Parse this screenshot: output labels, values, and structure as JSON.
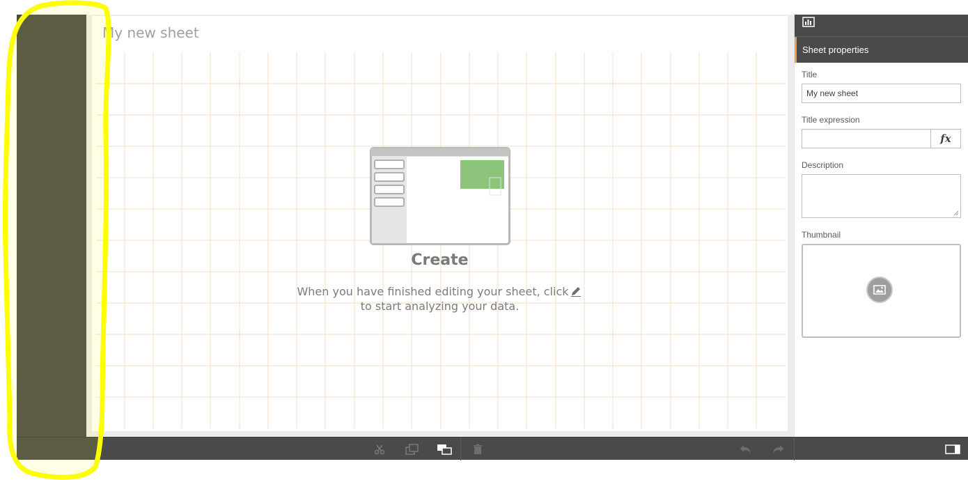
{
  "sheet": {
    "title": "My new sheet"
  },
  "empty_state": {
    "title": "Create",
    "description_before_icon": "When you have finished editing your sheet, click",
    "description_after_icon": "to start analyzing your data.",
    "inline_icon": "pencil-icon"
  },
  "properties_panel": {
    "top_icon": "chart-icon",
    "header": "Sheet properties",
    "title_label": "Title",
    "title_value": "My new sheet",
    "title_expression_label": "Title expression",
    "title_expression_value": "",
    "fx_label": "fx",
    "description_label": "Description",
    "description_value": "",
    "thumbnail_label": "Thumbnail",
    "thumbnail_icon": "image-icon"
  },
  "toolbar": {
    "buttons": [
      "cut-icon",
      "copy-icon",
      "paste-icon",
      "delete-icon",
      "undo-icon",
      "redo-icon",
      "toggle-panel-icon"
    ]
  },
  "colors": {
    "dark_panel": "#4a4a4a",
    "accent": "#f39c4b",
    "grid_line": "#f6dcc4",
    "green_tile": "#8cc47c",
    "annotation": "#ffff00"
  }
}
